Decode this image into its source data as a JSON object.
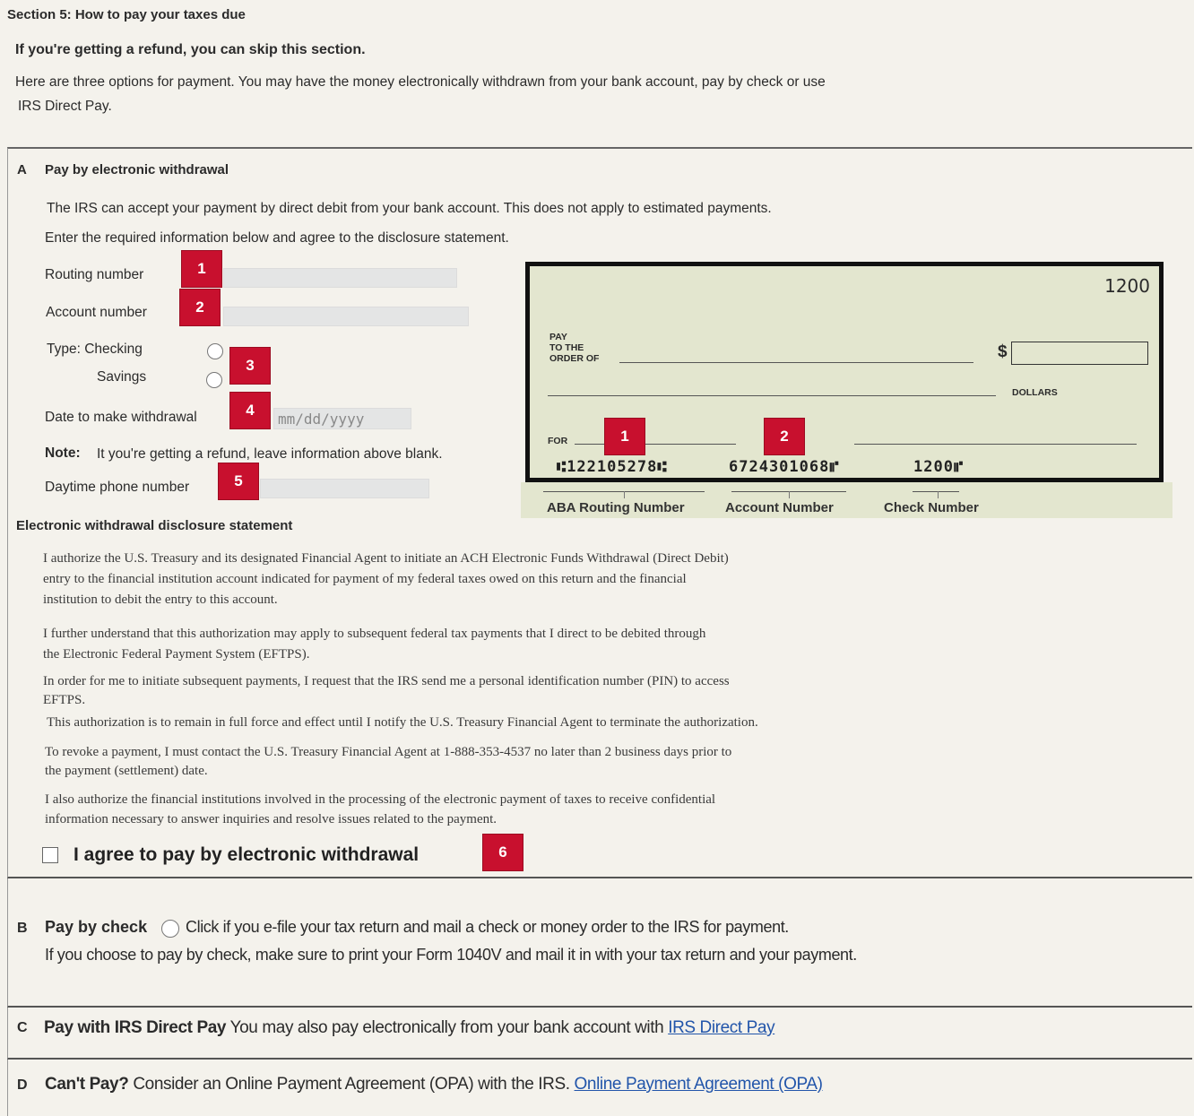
{
  "header": {
    "section_title": "Section 5: How to pay your taxes due",
    "refund_note": "If you're getting a refund, you can skip this section.",
    "intro_line1": "Here are three options for payment. You may have the money electronically withdrawn from your bank account, pay by check or use",
    "intro_line2": "IRS Direct Pay."
  },
  "section_a": {
    "letter": "A",
    "title": "Pay by electronic withdrawal",
    "desc1": "The IRS can accept your payment by direct debit from your bank account. This does not apply to estimated payments.",
    "desc2": "Enter the required information below and agree to the disclosure statement.",
    "routing_label": "Routing number",
    "account_label": "Account number",
    "type_label": "Type: Checking",
    "savings_label": "Savings",
    "date_label": "Date to make withdrawal",
    "date_placeholder": "mm/dd/yyyy",
    "note_label": "Note:",
    "note_text": "It you're getting a refund, leave information above blank.",
    "phone_label": "Daytime phone number",
    "badges": [
      "1",
      "2",
      "3",
      "4",
      "5",
      "6"
    ]
  },
  "check_image": {
    "check_number_top": "1200",
    "pay_line1": "PAY",
    "pay_line2": "TO THE",
    "pay_line3": "ORDER OF",
    "dollar_sign": "$",
    "dollars_label": "DOLLARS",
    "for_label": "FOR",
    "micr_routing": "⑆122105278⑆",
    "micr_account": "6724301068⑈",
    "micr_check": "1200⑈",
    "badge1": "1",
    "badge2": "2",
    "caption_routing": "ABA Routing Number",
    "caption_account": "Account Number",
    "caption_check": "Check Number"
  },
  "disclosure": {
    "title": "Electronic withdrawal disclosure statement",
    "p1_l1": "I authorize the U.S. Treasury and its designated Financial Agent to initiate an ACH Electronic Funds Withdrawal (Direct Debit)",
    "p1_l2": "entry to the financial institution account indicated for payment of my federal taxes owed on this return and the financial",
    "p1_l3": "institution to debit the entry to this account.",
    "p2_l1": "I further understand that this authorization may apply to subsequent federal tax payments that I direct to be debited through",
    "p2_l2": "the Electronic Federal Payment System (EFTPS).",
    "p3_l1": "In order for me to initiate subsequent payments, I request that the IRS send me a personal identification number (PIN) to access",
    "p3_l2": "EFTPS.",
    "p4_l1": "This authorization is to remain in full force and effect until I notify the U.S. Treasury Financial Agent to terminate the authorization.",
    "p5_l1": "To revoke a payment, I must contact the U.S. Treasury Financial Agent at 1-888-353-4537 no later than 2 business days prior to",
    "p5_l2": "the payment (settlement) date.",
    "p6_l1": "I also authorize the financial institutions involved in the processing of the electronic payment of taxes to receive confidential",
    "p6_l2": "information necessary to answer inquiries and resolve issues related to the payment.",
    "agree_label": "I agree to pay by electronic withdrawal"
  },
  "section_b": {
    "letter": "B",
    "title": "Pay by check",
    "radio_text": "Click if you e-file your tax return and mail a check or money order to the IRS for payment.",
    "line2": "If you choose to pay by check, make sure to print your Form 1040V and mail it in with your tax return and your payment."
  },
  "section_c": {
    "letter": "C",
    "title": "Pay with IRS Direct Pay",
    "text": "You may also pay electronically from your bank account with",
    "link": "IRS Direct Pay"
  },
  "section_d": {
    "letter": "D",
    "title": "Can't Pay?",
    "text": "Consider an Online Payment Agreement (OPA) with the IRS.",
    "link": "Online Payment Agreement (OPA)"
  },
  "colors": {
    "badge": "#c8102e",
    "check_bg": "#e3e6cf",
    "link": "#2255aa",
    "page_bg": "#f4f2ec"
  }
}
